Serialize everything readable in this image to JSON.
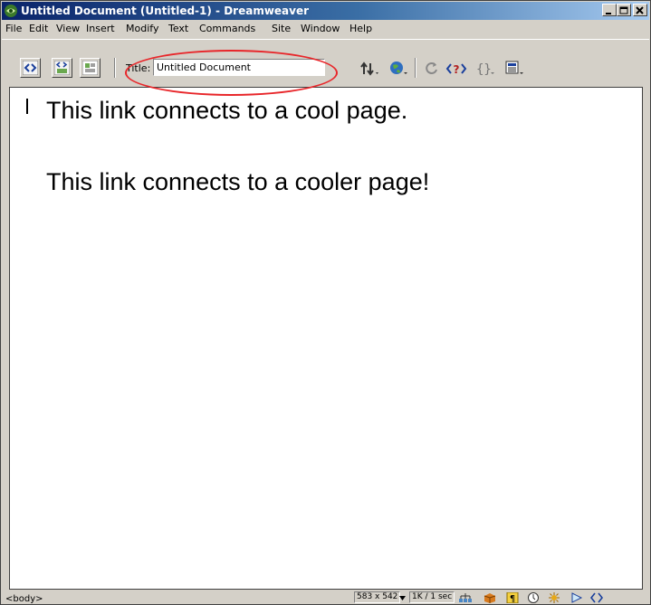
{
  "window": {
    "title": "Untitled Document (Untitled-1) - Dreamweaver",
    "app_icon": "dreamweaver-logo-icon",
    "controls": [
      "minimize-icon",
      "maximize-icon",
      "close-icon"
    ]
  },
  "menu": [
    "File",
    "Edit",
    "View",
    "Insert",
    "Modify",
    "Text",
    "Commands",
    "Site",
    "Window",
    "Help"
  ],
  "toolbar": {
    "view_buttons": [
      "code-view-icon",
      "code-design-view-icon",
      "design-view-icon"
    ],
    "title_label": "Title:",
    "title_value": "Untitled Document",
    "tool_icons": [
      "file-management-icon",
      "preview-browser-icon",
      "refresh-icon",
      "reference-icon",
      "code-navigation-icon",
      "view-options-icon"
    ]
  },
  "annotation": {
    "color": "#e8262a",
    "shape": "ellipse around title field"
  },
  "document": {
    "paragraphs": [
      "This link connects to a cool page.",
      "This link connects to a cooler page!"
    ]
  },
  "status": {
    "tag_selector": "<body>",
    "window_size": "583 x 542",
    "download": "1K / 1 sec",
    "launcher_icons": [
      "site-icon",
      "assets-icon",
      "html-styles-icon",
      "css-styles-icon",
      "behaviors-icon",
      "history-icon",
      "code-inspector-icon"
    ]
  },
  "colors": {
    "titlebar_start": "#0a246a",
    "titlebar_end": "#a6caf0",
    "chrome": "#d4d0c8",
    "annotation": "#e8262a"
  }
}
